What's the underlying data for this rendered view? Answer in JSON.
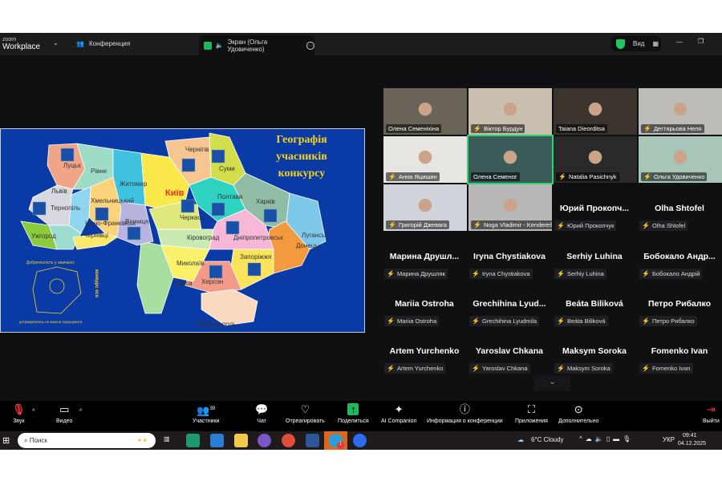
{
  "titlebar": {
    "brand_small": "zoom",
    "brand": "Workplace",
    "meeting_tab": "Конференция",
    "share_tab": "Экран (Ольга Удовиченко)",
    "view_label": "Вид"
  },
  "slide": {
    "title": [
      "Географія",
      "учасників",
      "конкурсу"
    ],
    "cities": [
      "Луцьк",
      "Рівне",
      "Житомир",
      "Київ",
      "Чернігів",
      "Суми",
      "Львів",
      "Тернопіль",
      "Хмельницький",
      "Вінниця",
      "Івано-Франківськ",
      "Ужгород",
      "Чернівці",
      "Полтава",
      "Харків",
      "Черкаси",
      "Кіровоград",
      "Дніпропетровськ",
      "Луганськ",
      "Донецьк",
      "Запоріжжя",
      "Миколаїв",
      "Херсон",
      "Одеса",
      "Сімферополь"
    ],
    "logo_top": "Доброчесність у навчанні:",
    "logo_side": "конкурс есе",
    "logo_bottom": "дотримуватись не можна порушувати"
  },
  "video_tiles": [
    "Олена Семеніхіна",
    "Віктор Бурдун",
    "Taiana Dieorditsa",
    "Дегтярьова Неля",
    "Анна Яцишин",
    "Олена Семеног",
    "Natalia Pasichnyk",
    "Ольга Удовиченко",
    "Григорій Джевага",
    "Noga Vladimir - Kendereš..."
  ],
  "name_tiles": [
    {
      "big": "Юрий Прокопч...",
      "small": "Юрий Прокопчук"
    },
    {
      "big": "Olha Shtofel",
      "small": "Olha Shtofel"
    },
    {
      "big": "Марина Друшл...",
      "small": "Марина Друшляк"
    },
    {
      "big": "Iryna Chystiakova",
      "small": "Iryna Chystiakova"
    },
    {
      "big": "Serhiy Luhina",
      "small": "Serhiy Luhina"
    },
    {
      "big": "Бобокало Андр...",
      "small": "Бобокало Андрій"
    },
    {
      "big": "Mariia Ostroha",
      "small": "Mariia Ostroha"
    },
    {
      "big": "Grechihina Lyud...",
      "small": "Grechihina Lyudmila"
    },
    {
      "big": "Beáta Biliková",
      "small": "Beáta Biliková"
    },
    {
      "big": "Петро Рибалко",
      "small": "Петро Рибалко"
    },
    {
      "big": "Artem Yurchenko",
      "small": "Artem Yurchenko"
    },
    {
      "big": "Yaroslav Chkana",
      "small": "Yaroslav Chkana"
    },
    {
      "big": "Maksym Soroka",
      "small": "Maksym Soroka"
    },
    {
      "big": "Fomenko Ivan",
      "small": "Fomenko Ivan"
    }
  ],
  "toolbar": {
    "audio": "Звук",
    "video": "Видео",
    "participants": "Участники",
    "participants_count": "39",
    "chat": "Чат",
    "react": "Отреагировать",
    "share": "Поделиться",
    "ai": "AI Companion",
    "info": "Информация о конференции",
    "apps": "Приложения",
    "more": "Дополнительно",
    "leave": "Выйти"
  },
  "taskbar": {
    "search_placeholder": "Поиск",
    "weather": "6°C Cloudy",
    "lang": "УКР",
    "time": "09:41",
    "date": "04.12.2025",
    "badge": "1"
  },
  "colors": {
    "accent_green": "#1fb85c",
    "mute_red": "#e5343a",
    "slide_bg": "#0a3aa6",
    "title_yellow": "#f5d21c"
  }
}
